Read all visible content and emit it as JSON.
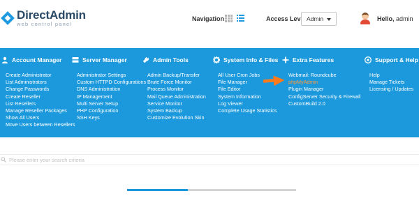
{
  "header": {
    "logo_title": "DirectAdmin",
    "logo_subtitle": "web control panel",
    "navigation_label": "Navigation",
    "access_level_label": "Access Level",
    "access_level_value": "Admin",
    "greeting": "Hello,",
    "username": "admin"
  },
  "menu": {
    "background": "#1b99dc",
    "highlight_color": "#ff9a3c",
    "columns": [
      {
        "title": "Account Manager",
        "icon": "user-icon",
        "items": [
          "Create Administrator",
          "List Administrators",
          "Change Passwords",
          "Create Reseller",
          "List Resellers",
          "Manage Reseller Packages",
          "Show All Users",
          "Move Users between Resellers"
        ]
      },
      {
        "title": "Server Manager",
        "icon": "server-icon",
        "items": [
          "Administrator Settings",
          "Custom HTTPD Configurations",
          "DNS Administration",
          "IP Management",
          "Multi Server Setup",
          "PHP Configuration",
          "SSH Keys"
        ]
      },
      {
        "title": "Admin Tools",
        "icon": "wrench-icon",
        "items": [
          "Admin Backup/Transfer",
          "Brute Force Monitor",
          "Process Monitor",
          "Mail Queue Administration",
          "Service Monitor",
          "System Backup",
          "Customize Evolution Skin"
        ]
      },
      {
        "title": "System Info & Files",
        "icon": "gear-icon",
        "items": [
          "All User Cron Jobs",
          "File Manager",
          "File Editor",
          "System Information",
          "Log Viewer",
          "Complete Usage Statistics"
        ]
      },
      {
        "title": "Extra Features",
        "icon": "puzzle-icon",
        "items": [
          "Webmail: Roundcube",
          "phpMyAdmin",
          "Plugin Manager",
          "ConfigServer Security & Firewall",
          "CustomBuild 2.0"
        ]
      },
      {
        "title": "Support & Help",
        "icon": "help-circle-icon",
        "items": [
          "Help",
          "Manage Tickets",
          "Licensing / Updates"
        ]
      }
    ]
  },
  "search": {
    "placeholder": "Please enter your search criteria"
  },
  "progress": {
    "fraction": 0.36
  }
}
